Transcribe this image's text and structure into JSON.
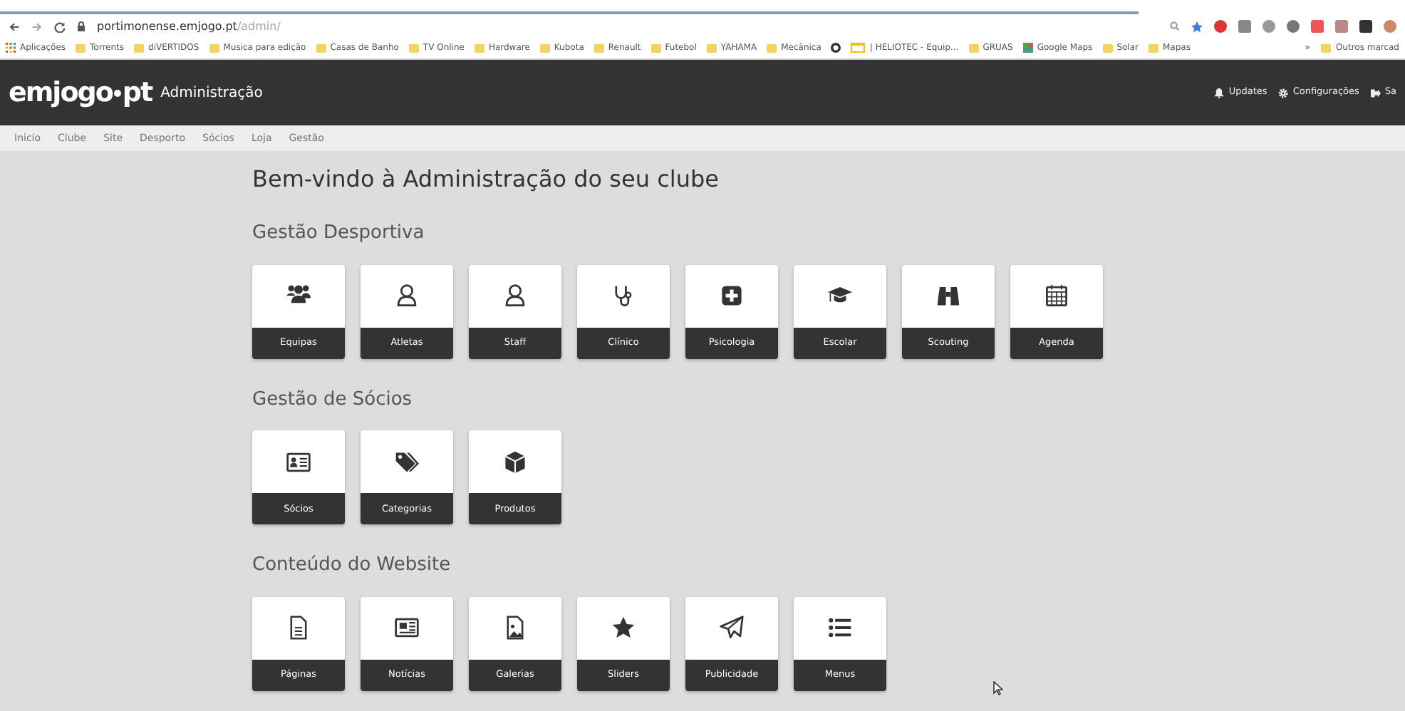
{
  "browser": {
    "url_host": "portimonense.emjogo.pt",
    "url_path": "/admin/",
    "bookmarks": [
      {
        "label": "Aplicações",
        "kind": "apps"
      },
      {
        "label": "Torrents",
        "kind": "folder"
      },
      {
        "label": "diVERTIDOS",
        "kind": "folder"
      },
      {
        "label": "Musica para edição",
        "kind": "folder"
      },
      {
        "label": "Casas de Banho",
        "kind": "folder"
      },
      {
        "label": "TV Online",
        "kind": "folder"
      },
      {
        "label": "Hardware",
        "kind": "folder"
      },
      {
        "label": "Kubota",
        "kind": "folder"
      },
      {
        "label": "Renault",
        "kind": "folder"
      },
      {
        "label": "Futebol",
        "kind": "folder"
      },
      {
        "label": "YAHAMA",
        "kind": "folder"
      },
      {
        "label": "Mecânica",
        "kind": "folder"
      },
      {
        "kind": "site"
      },
      {
        "label": "| HELIOTEC - Equip...",
        "kind": "page"
      },
      {
        "label": "GRUAS",
        "kind": "folder"
      },
      {
        "label": "Google Maps",
        "kind": "maps"
      },
      {
        "label": "Solar",
        "kind": "folder"
      },
      {
        "label": "Mapas",
        "kind": "folder"
      }
    ],
    "more": "»",
    "other": "Outros marcad"
  },
  "header": {
    "logo_main": "emjogo",
    "logo_dot": "pt",
    "subtitle": "Administração",
    "actions": [
      {
        "label": "Updates",
        "kind": "bell"
      },
      {
        "label": "Configurações",
        "kind": "gear"
      },
      {
        "label": "Sa",
        "kind": "exit"
      }
    ]
  },
  "nav": [
    "Inicio",
    "Clube",
    "Site",
    "Desporto",
    "Sócios",
    "Loja",
    "Gestão"
  ],
  "title": "Bem-vindo à Administração do seu clube",
  "sections": [
    {
      "heading": "Gestão Desportiva",
      "tiles": [
        "Equipas",
        "Atletas",
        "Staff",
        "Clínico",
        "Psicologia",
        "Escolar",
        "Scouting",
        "Agenda"
      ]
    },
    {
      "heading": "Gestão de Sócios",
      "tiles": [
        "Sócios",
        "Categorias",
        "Produtos"
      ]
    },
    {
      "heading": "Conteúdo do Website",
      "tiles": [
        "Páginas",
        "Notícias",
        "Galerias",
        "Sliders",
        "Publicidade",
        "Menus"
      ]
    }
  ]
}
